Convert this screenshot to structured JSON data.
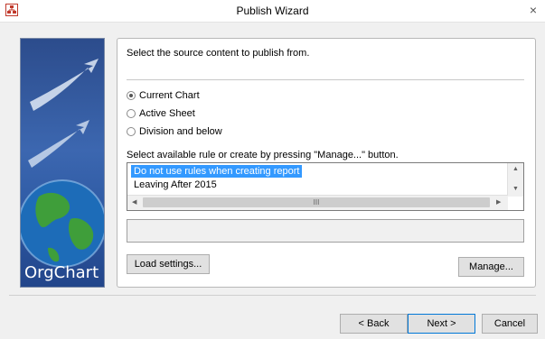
{
  "window": {
    "title": "Publish Wizard",
    "close_glyph": "×",
    "icon": "orgchart-app-icon"
  },
  "banner": {
    "logo_text": "OrgChart"
  },
  "main": {
    "prompt": "Select the source content to publish from.",
    "source_options": [
      {
        "label": "Current Chart",
        "selected": true
      },
      {
        "label": "Active Sheet",
        "selected": false
      },
      {
        "label": "Division and below",
        "selected": false
      }
    ],
    "rules_label": "Select available rule or create by pressing \"Manage...\" button.",
    "rules": [
      {
        "label": "Do not use rules when creating report",
        "selected": true
      },
      {
        "label": "Leaving After 2015",
        "selected": false
      }
    ],
    "scroll_thumb_glyph": "III",
    "load_settings_label": "Load settings...",
    "manage_label": "Manage..."
  },
  "footer": {
    "back_label": "< Back",
    "next_label": "Next >",
    "cancel_label": "Cancel"
  },
  "colors": {
    "selection": "#3399ff",
    "banner_blue": "#2e5aa4",
    "default_button_border": "#0078d7"
  }
}
